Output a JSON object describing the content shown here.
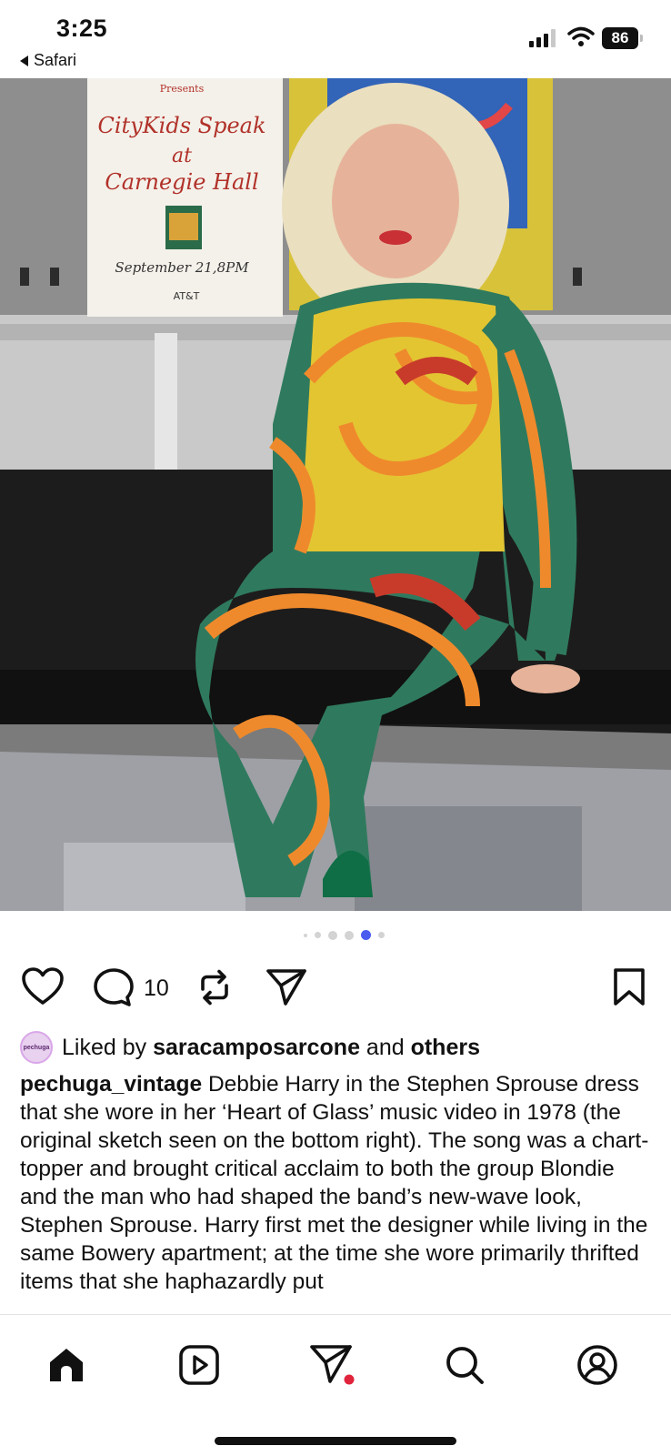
{
  "status_bar": {
    "time": "3:25",
    "back_app": "Safari",
    "battery": "86"
  },
  "post": {
    "image_alt": "Woman in colorful patterned bodysuit seated on a stage",
    "poster_text": {
      "presents": "Presents",
      "line1": "CityKids Speak",
      "line2": "at",
      "line3": "Carnegie Hall",
      "date": "September 21,8PM",
      "sponsor": "AT&T"
    },
    "carousel": {
      "count": 6,
      "active_index": 4
    },
    "comment_count": "10",
    "liked_by_prefix": "Liked by ",
    "liked_by_user": "saracamposarcone",
    "liked_by_middle": " and ",
    "liked_by_others": "others",
    "avatar_text": "pechuga",
    "username": "pechuga_vintage",
    "caption": " Debbie Harry in the Stephen Sprouse dress that she wore in her ‘Heart of Glass’ music video in 1978 (the original sketch seen on the bottom right). The song was a chart-topper and brought critical acclaim to both the group Blondie and the man who had shaped the band’s new-wave look, Stephen Sprouse. Harry first met the designer while living in the same Bowery apartment; at the time she wore primarily thrifted items that she haphazardly put"
  },
  "colors": {
    "accent_dot": "#4a5cf0",
    "notification_dot": "#e0243c"
  },
  "nav": {
    "items": [
      "home-icon",
      "reels-icon",
      "direct-message-icon",
      "search-icon",
      "profile-icon"
    ]
  }
}
